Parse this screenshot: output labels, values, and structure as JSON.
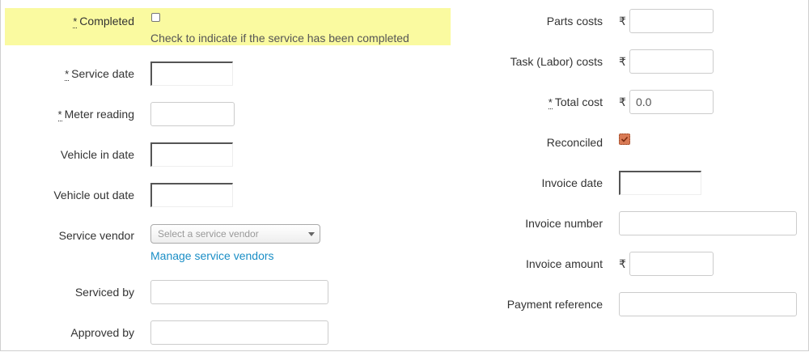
{
  "left": {
    "completed": {
      "label": "Completed",
      "hint": "Check to indicate if the service has been completed",
      "checked": false
    },
    "service_date": {
      "label": "Service date",
      "value": ""
    },
    "meter_reading": {
      "label": "Meter reading",
      "value": ""
    },
    "vehicle_in_date": {
      "label": "Vehicle in date",
      "value": ""
    },
    "vehicle_out_date": {
      "label": "Vehicle out date",
      "value": ""
    },
    "service_vendor": {
      "label": "Service vendor",
      "placeholder": "Select a service vendor",
      "manage_link": "Manage service vendors"
    },
    "serviced_by": {
      "label": "Serviced by",
      "value": ""
    },
    "approved_by": {
      "label": "Approved by",
      "value": ""
    }
  },
  "right": {
    "currency_symbol": "₹",
    "parts_costs": {
      "label": "Parts costs",
      "value": ""
    },
    "task_labor_costs": {
      "label": "Task (Labor) costs",
      "value": ""
    },
    "total_cost": {
      "label": "Total cost",
      "value": "0.0"
    },
    "reconciled": {
      "label": "Reconciled",
      "checked": true
    },
    "invoice_date": {
      "label": "Invoice date",
      "value": ""
    },
    "invoice_number": {
      "label": "Invoice number",
      "value": ""
    },
    "invoice_amount": {
      "label": "Invoice amount",
      "value": ""
    },
    "payment_reference": {
      "label": "Payment reference",
      "value": ""
    }
  },
  "required_marker": "*",
  "colors": {
    "highlight": "#fafaa0",
    "link": "#1a8ec6",
    "checked": "#d97a55"
  }
}
